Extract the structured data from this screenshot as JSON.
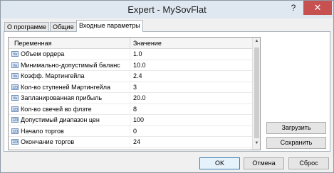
{
  "window": {
    "title": "Expert - MySovFlat",
    "help": "?",
    "close": "✕"
  },
  "tabs": [
    {
      "label": "О программе"
    },
    {
      "label": "Общие"
    },
    {
      "label": "Входные параметры"
    }
  ],
  "grid": {
    "headers": {
      "variable": "Переменная",
      "value": "Значение"
    },
    "rows": [
      {
        "icon": "Va",
        "name": "Объем ордера",
        "value": "1.0"
      },
      {
        "icon": "Va",
        "name": "Минимально-допустимый баланс",
        "value": "10.0"
      },
      {
        "icon": "Va",
        "name": "Коэфф. Мартингейла",
        "value": "2.4"
      },
      {
        "icon": "123",
        "name": "Кол-во ступеней Мартингейла",
        "value": "3"
      },
      {
        "icon": "Va",
        "name": "Запланированная прибыль",
        "value": "20.0"
      },
      {
        "icon": "123",
        "name": "Кол-во свечей во флэте",
        "value": "8"
      },
      {
        "icon": "123",
        "name": "Допустимый диапазон цен",
        "value": "100"
      },
      {
        "icon": "123",
        "name": "Начало торгов",
        "value": "0"
      },
      {
        "icon": "123",
        "name": "Окончание торгов",
        "value": "24"
      }
    ],
    "scroll": {
      "up": "▲",
      "down": "▼"
    }
  },
  "side_buttons": {
    "load": "Загрузить",
    "save": "Сохранить"
  },
  "footer": {
    "ok": "OK",
    "cancel": "Отмена",
    "reset": "Сброс"
  }
}
